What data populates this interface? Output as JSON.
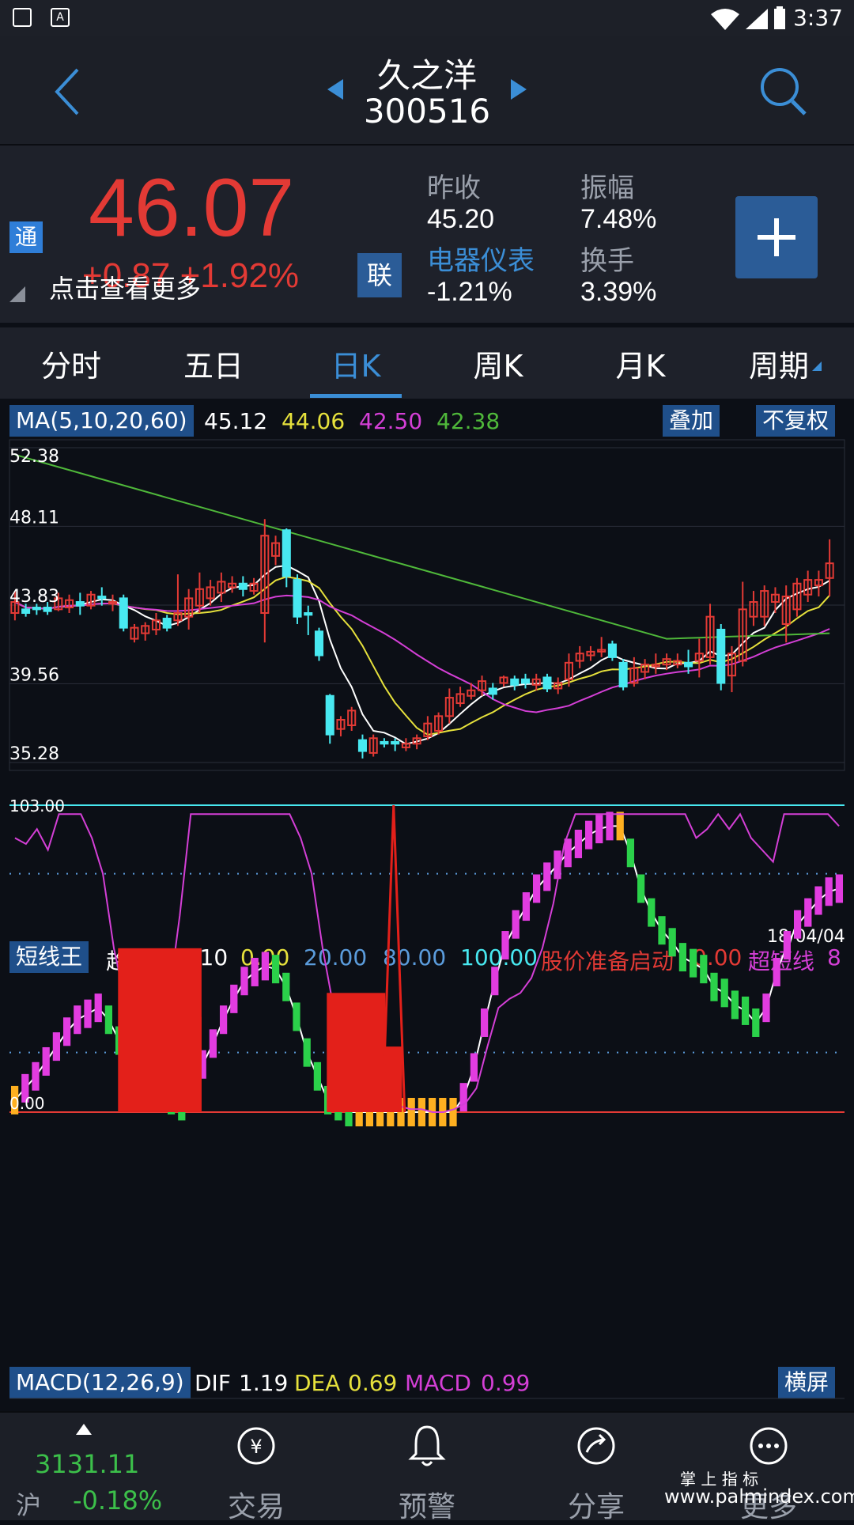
{
  "statusbar": {
    "time": "3:37"
  },
  "header": {
    "name": "久之洋",
    "code": "300516"
  },
  "quote": {
    "price": "46.07",
    "change_amt": "+0.87",
    "change_pct": "+1.92%",
    "more_hint": "点击查看更多",
    "tong_badge": "通",
    "lian_badge": "联",
    "prev_close_label": "昨收",
    "prev_close": "45.20",
    "amplitude_label": "振幅",
    "amplitude": "7.48%",
    "sector": "电器仪表",
    "sector_change": "-1.21%",
    "turnover_label": "换手",
    "turnover": "3.39%"
  },
  "tabs": [
    "分时",
    "五日",
    "日K",
    "周K",
    "月K",
    "周期"
  ],
  "ma_legend": {
    "label": "MA(5,10,20,60)",
    "ma5": "45.12",
    "ma10": "44.06",
    "ma20": "42.50",
    "ma60": "42.38",
    "overlay_btn": "叠加",
    "adjust_btn": "不复权"
  },
  "price_axis": [
    "52.38",
    "48.11",
    "43.83",
    "39.56",
    "35.28"
  ],
  "indicator_legend": {
    "label": "短线王",
    "trend_label": "趋势",
    "trend": "73.10",
    "v1": "0.00",
    "v2": "20.00",
    "v3": "80.00",
    "v4": "100.00",
    "signal_label": "股价准备启动",
    "signal": "0.00",
    "super_label": "超短线",
    "super": "8",
    "date": "18/04/04"
  },
  "indicator_axis": {
    "top": "103.00",
    "bottom": "0.00"
  },
  "macd_legend": {
    "label": "MACD(12,26,9)",
    "dif_label": "DIF",
    "dif": "1.19",
    "dea_label": "DEA",
    "dea": "0.69",
    "macd_label": "MACD",
    "macd": "0.99",
    "landscape_btn": "横屏"
  },
  "bottom_nav": {
    "index_value": "3131.11",
    "index_name": "沪",
    "index_change": "-0.18%",
    "trade": "交易",
    "alert": "预警",
    "share": "分享",
    "more": "更多"
  },
  "watermark": {
    "line1": "掌 上 指 标",
    "line2": "www.palmindex.com"
  },
  "colors": {
    "up": "#e33a35",
    "down": "#48e8f0",
    "ma5": "#ffffff",
    "ma10": "#e6e13c",
    "ma20": "#d43fd6",
    "ma60": "#4fb83a",
    "accent": "#3b8ed6"
  },
  "chart_data": {
    "type": "candlestick",
    "y_range": [
      35.28,
      52.38
    ],
    "grid": true,
    "candles": [
      [
        43.4,
        44.0,
        43.0,
        44.6
      ],
      [
        43.6,
        43.4,
        43.2,
        43.9
      ],
      [
        43.7,
        43.6,
        43.3,
        43.9
      ],
      [
        43.7,
        43.5,
        43.3,
        44.0
      ],
      [
        43.6,
        44.2,
        43.5,
        44.5
      ],
      [
        43.7,
        44.1,
        43.4,
        44.4
      ],
      [
        44.0,
        43.8,
        43.3,
        44.5
      ],
      [
        43.8,
        44.4,
        43.6,
        44.6
      ],
      [
        44.3,
        44.2,
        43.8,
        44.8
      ],
      [
        43.9,
        44.0,
        43.5,
        44.4
      ],
      [
        44.2,
        42.6,
        42.4,
        44.4
      ],
      [
        42.0,
        42.6,
        41.8,
        42.8
      ],
      [
        42.3,
        42.7,
        41.9,
        42.9
      ],
      [
        42.5,
        43.0,
        42.2,
        43.4
      ],
      [
        43.1,
        42.6,
        42.4,
        43.3
      ],
      [
        43.0,
        43.4,
        42.7,
        45.5
      ],
      [
        43.2,
        44.2,
        42.5,
        44.7
      ],
      [
        43.8,
        44.7,
        43.4,
        45.6
      ],
      [
        44.2,
        44.8,
        43.8,
        45.2
      ],
      [
        44.5,
        45.1,
        44.0,
        45.6
      ],
      [
        44.8,
        45.0,
        44.5,
        45.4
      ],
      [
        45.0,
        44.7,
        44.3,
        45.4
      ],
      [
        44.6,
        45.0,
        44.4,
        45.3
      ],
      [
        43.4,
        47.6,
        41.8,
        48.5
      ],
      [
        46.5,
        47.2,
        46.0,
        47.6
      ],
      [
        47.9,
        45.4,
        44.8,
        48.0
      ],
      [
        45.2,
        43.2,
        42.8,
        45.5
      ],
      [
        43.4,
        43.3,
        42.2,
        43.8
      ],
      [
        42.4,
        41.1,
        40.8,
        42.6
      ],
      [
        38.9,
        36.8,
        36.3,
        39.0
      ],
      [
        37.1,
        37.6,
        36.7,
        37.8
      ],
      [
        37.3,
        38.1,
        37.0,
        38.3
      ],
      [
        36.5,
        35.9,
        35.5,
        36.8
      ],
      [
        35.8,
        36.6,
        35.6,
        36.8
      ],
      [
        36.4,
        36.3,
        36.1,
        36.6
      ],
      [
        36.4,
        36.3,
        35.9,
        36.6
      ],
      [
        36.1,
        36.3,
        35.9,
        36.6
      ],
      [
        36.3,
        36.6,
        36.0,
        36.8
      ],
      [
        36.7,
        37.4,
        36.5,
        37.8
      ],
      [
        37.0,
        37.8,
        36.8,
        38.0
      ],
      [
        37.8,
        38.8,
        37.4,
        39.3
      ],
      [
        38.5,
        39.0,
        38.3,
        39.4
      ],
      [
        38.9,
        39.2,
        38.7,
        39.6
      ],
      [
        39.2,
        39.7,
        38.9,
        40.0
      ],
      [
        39.3,
        39.0,
        38.7,
        39.6
      ],
      [
        39.6,
        39.9,
        39.4,
        40.0
      ],
      [
        39.8,
        39.5,
        39.2,
        40.0
      ],
      [
        39.8,
        39.6,
        39.3,
        40.1
      ],
      [
        39.5,
        39.8,
        39.2,
        40.1
      ],
      [
        39.9,
        39.3,
        39.1,
        40.1
      ],
      [
        39.3,
        39.6,
        39.0,
        39.9
      ],
      [
        39.8,
        40.7,
        39.4,
        41.2
      ],
      [
        40.8,
        41.2,
        40.4,
        41.6
      ],
      [
        41.1,
        41.3,
        40.8,
        41.6
      ],
      [
        41.3,
        41.4,
        41.0,
        42.1
      ],
      [
        41.7,
        41.0,
        40.8,
        41.9
      ],
      [
        40.7,
        39.4,
        39.2,
        40.9
      ],
      [
        39.6,
        40.4,
        39.4,
        41.0
      ],
      [
        40.2,
        40.6,
        39.8,
        40.9
      ],
      [
        40.5,
        40.6,
        40.1,
        41.2
      ],
      [
        40.6,
        40.9,
        40.3,
        41.2
      ],
      [
        40.6,
        40.8,
        40.4,
        41.2
      ],
      [
        40.7,
        40.5,
        40.1,
        41.4
      ],
      [
        40.8,
        41.2,
        39.9,
        42.0
      ],
      [
        41.0,
        43.2,
        40.6,
        43.9
      ],
      [
        42.5,
        39.6,
        39.2,
        42.8
      ],
      [
        40.0,
        41.2,
        39.1,
        41.6
      ],
      [
        40.8,
        43.6,
        40.5,
        45.1
      ],
      [
        43.2,
        44.0,
        42.7,
        44.6
      ],
      [
        43.2,
        44.6,
        42.7,
        44.9
      ],
      [
        44.0,
        44.4,
        43.4,
        44.8
      ],
      [
        42.8,
        44.3,
        41.8,
        44.9
      ],
      [
        43.6,
        45.0,
        43.2,
        45.3
      ],
      [
        44.4,
        45.2,
        44.0,
        45.7
      ],
      [
        44.9,
        45.2,
        44.3,
        45.7
      ],
      [
        45.3,
        46.1,
        44.3,
        47.4
      ]
    ],
    "series": [
      {
        "name": "MA5",
        "color": "#ffffff"
      },
      {
        "name": "MA10",
        "color": "#e6e13c"
      },
      {
        "name": "MA20",
        "color": "#d43fd6"
      },
      {
        "name": "MA60",
        "color": "#4fb83a"
      }
    ],
    "indicator": {
      "y_range": [
        0,
        103
      ],
      "trend": [
        4,
        8,
        12,
        17,
        22,
        27,
        31,
        33,
        35,
        31,
        24,
        20,
        14,
        8,
        5,
        4,
        2,
        8,
        16,
        23,
        31,
        38,
        44,
        47,
        49,
        48,
        42,
        32,
        20,
        12,
        4,
        2,
        0,
        0,
        0,
        0,
        0,
        0,
        0,
        0,
        0,
        0,
        0,
        5,
        15,
        30,
        44,
        56,
        63,
        69,
        75,
        79,
        83,
        87,
        90,
        93,
        95,
        96,
        96,
        87,
        75,
        67,
        61,
        57,
        52,
        50,
        48,
        42,
        40,
        36,
        34,
        30,
        35,
        47,
        56,
        63,
        67,
        71,
        74,
        75
      ],
      "super": [
        92,
        90,
        95,
        88,
        100,
        100,
        100,
        92,
        80,
        55,
        38,
        35,
        30,
        32,
        38,
        66,
        100,
        100,
        100,
        100,
        100,
        100,
        100,
        100,
        100,
        100,
        92,
        80,
        55,
        35,
        20,
        10,
        5,
        3,
        2,
        2,
        1,
        1,
        0,
        0,
        1,
        3,
        8,
        22,
        35,
        38,
        40,
        45,
        55,
        70,
        90,
        100,
        100,
        100,
        100,
        100,
        100,
        100,
        100,
        100,
        100,
        100,
        92,
        95,
        100,
        95,
        100,
        92,
        88,
        84,
        100,
        100,
        100,
        100,
        100,
        96
      ]
    }
  }
}
